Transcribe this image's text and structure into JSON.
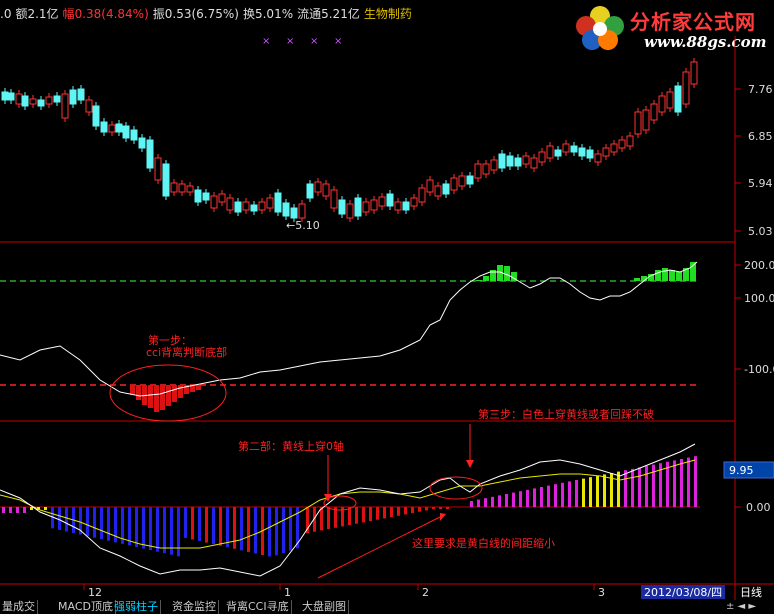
{
  "header": {
    "seg0": ".0",
    "seg1": "额2.1亿",
    "seg2": "幅",
    "seg3": "0.38(4.84%)",
    "seg4": "振0.53(6.75%)",
    "seg5": "换5.01%",
    "seg6": "流通5.21亿",
    "seg7": "生物制药",
    "markers": [
      "×",
      "×",
      "×",
      "×"
    ]
  },
  "logo": {
    "title": "分析家公式网",
    "url": "www.88gs.com"
  },
  "price_axis": [
    "7.76",
    "6.85",
    "5.94",
    "5.03"
  ],
  "low_label": "←5.10",
  "cci_axis": [
    "200.00",
    "100.00",
    "-100.00"
  ],
  "osc_axis": [
    "9.95",
    "0.00"
  ],
  "date_axis": {
    "labels": [
      "12",
      "1",
      "2",
      "3"
    ],
    "current_date": "2012/03/08/四",
    "period": "日线"
  },
  "annotations": {
    "step1_line1": "第一步：",
    "step1_line2": "cci背离判断底部",
    "step2": "第二部：黄线上穿0轴",
    "step3": "第三步：白色上穿黄线或者回踩不破",
    "note": "这里要求是黄白线的间距缩小"
  },
  "tabs": [
    "量成交",
    "MACD顶底",
    "强弱柱子",
    "资金监控",
    "背离CCI寻底",
    "大盘副图"
  ],
  "active_tab": "强弱柱子",
  "colors": {
    "up": "#ff3333",
    "down": "#5ff5f5",
    "cci_line": "#ffffff",
    "dashed_green": "#33cc33",
    "dashed_red": "#ff2222",
    "annotation": "#ff2020"
  }
}
